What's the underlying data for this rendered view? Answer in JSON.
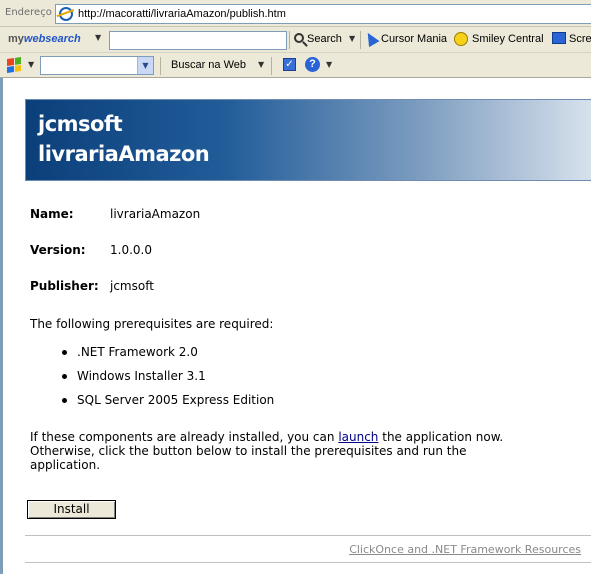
{
  "browser": {
    "address_label": "Endereço",
    "url": "http://macoratti/livrariaAmazon/publish.htm",
    "toolbar1": {
      "brand_prefix": "my",
      "brand_main": "websearch",
      "search_label": "Search",
      "cursor_label": "Cursor Mania",
      "smiley_label": "Smiley Central",
      "screen_label": "Scre"
    },
    "toolbar2": {
      "combo_value": "",
      "buscar_label": "Buscar na Web"
    }
  },
  "banner": {
    "line1": "jcmsoft",
    "line2": "livrariaAmazon"
  },
  "fields": {
    "name_label": "Name:",
    "name_value": "livrariaAmazon",
    "version_label": "Version:",
    "version_value": "1.0.0.0",
    "publisher_label": "Publisher:",
    "publisher_value": "jcmsoft"
  },
  "prereq": {
    "intro": "The following prerequisites are required:",
    "items": [
      ".NET Framework 2.0",
      "Windows Installer 3.1",
      "SQL Server 2005 Express Edition"
    ]
  },
  "note": {
    "before": "If these components are already installed, you can ",
    "link": "launch",
    "after": " the application now. Otherwise, click the button below to install the prerequisites and run the application."
  },
  "install_label": "Install",
  "footer_link": "ClickOnce and .NET Framework Resources",
  "colors": {
    "banner_dark": "#0b3f7a",
    "banner_light": "#d7e1ec",
    "chrome": "#ece9d8",
    "link": "#00008b"
  }
}
